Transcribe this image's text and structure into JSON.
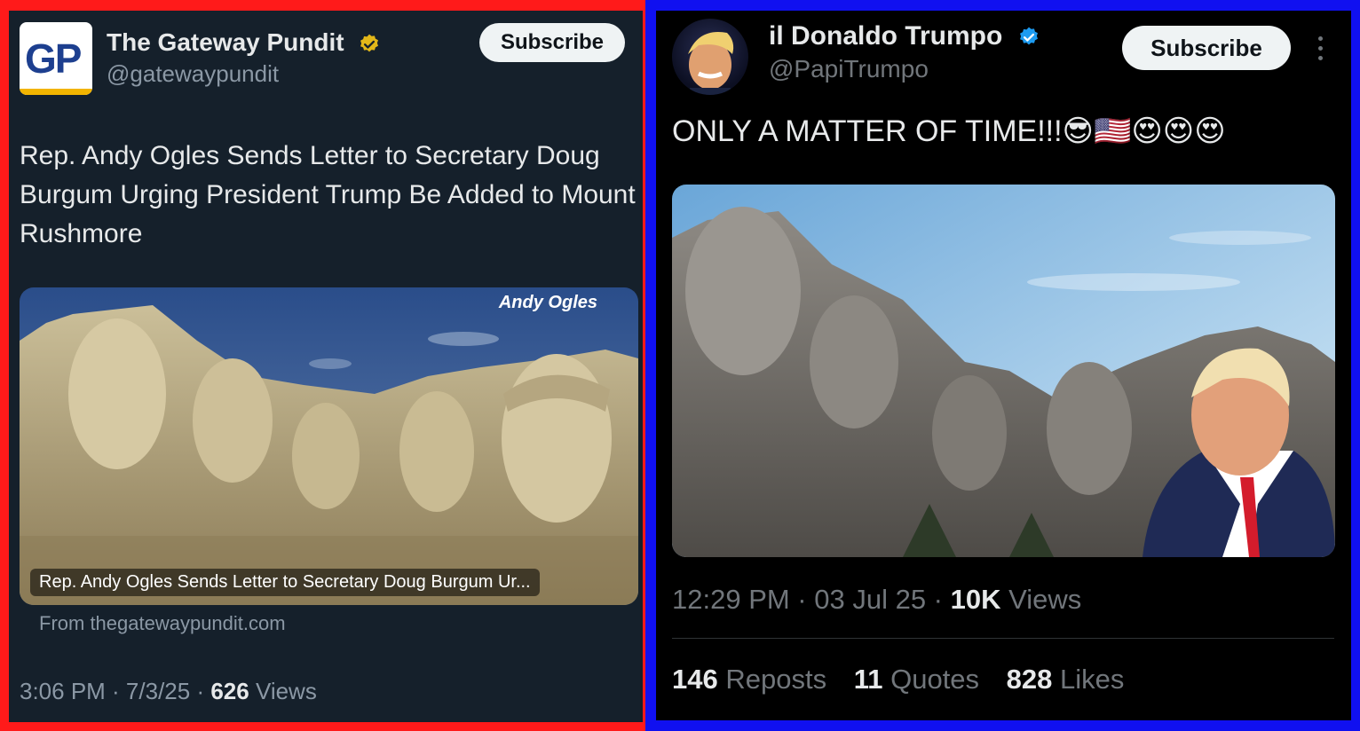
{
  "left_post": {
    "author_name": "The Gateway Pundit",
    "author_handle": "@gatewaypundit",
    "avatar_text": "GP",
    "subscribe_label": "Subscribe",
    "text": "Rep. Andy Ogles Sends Letter to Secretary Doug Burgum Urging President Trump Be Added to Mount Rushmore",
    "card_watermark": "Andy Ogles",
    "card_caption": "Rep. Andy Ogles Sends Letter to Secretary Doug Burgum Ur...",
    "card_source": "From thegatewaypundit.com",
    "time": "3:06 PM · 7/3/25 · ",
    "views_count": "626",
    "views_label": " Views"
  },
  "right_post": {
    "author_name": "il Donaldo Trumpo",
    "author_handle": "@PapiTrumpo",
    "subscribe_label": "Subscribe",
    "text": "ONLY A MATTER OF TIME!!!😎🇺🇸😍😍😍",
    "time": "12:29 PM · 03 Jul 25 · ",
    "views_count": "10K",
    "views_label": " Views",
    "reposts_count": "146",
    "reposts_label": " Reposts",
    "quotes_count": "11",
    "quotes_label": " Quotes",
    "likes_count": "828",
    "likes_label": " Likes"
  },
  "colors": {
    "left_border": "#ff1a1a",
    "right_border": "#1010f0",
    "left_bg": "#15202b",
    "right_bg": "#000000",
    "verified_gold": "#e2b719",
    "verified_blue": "#1d9bf0"
  }
}
